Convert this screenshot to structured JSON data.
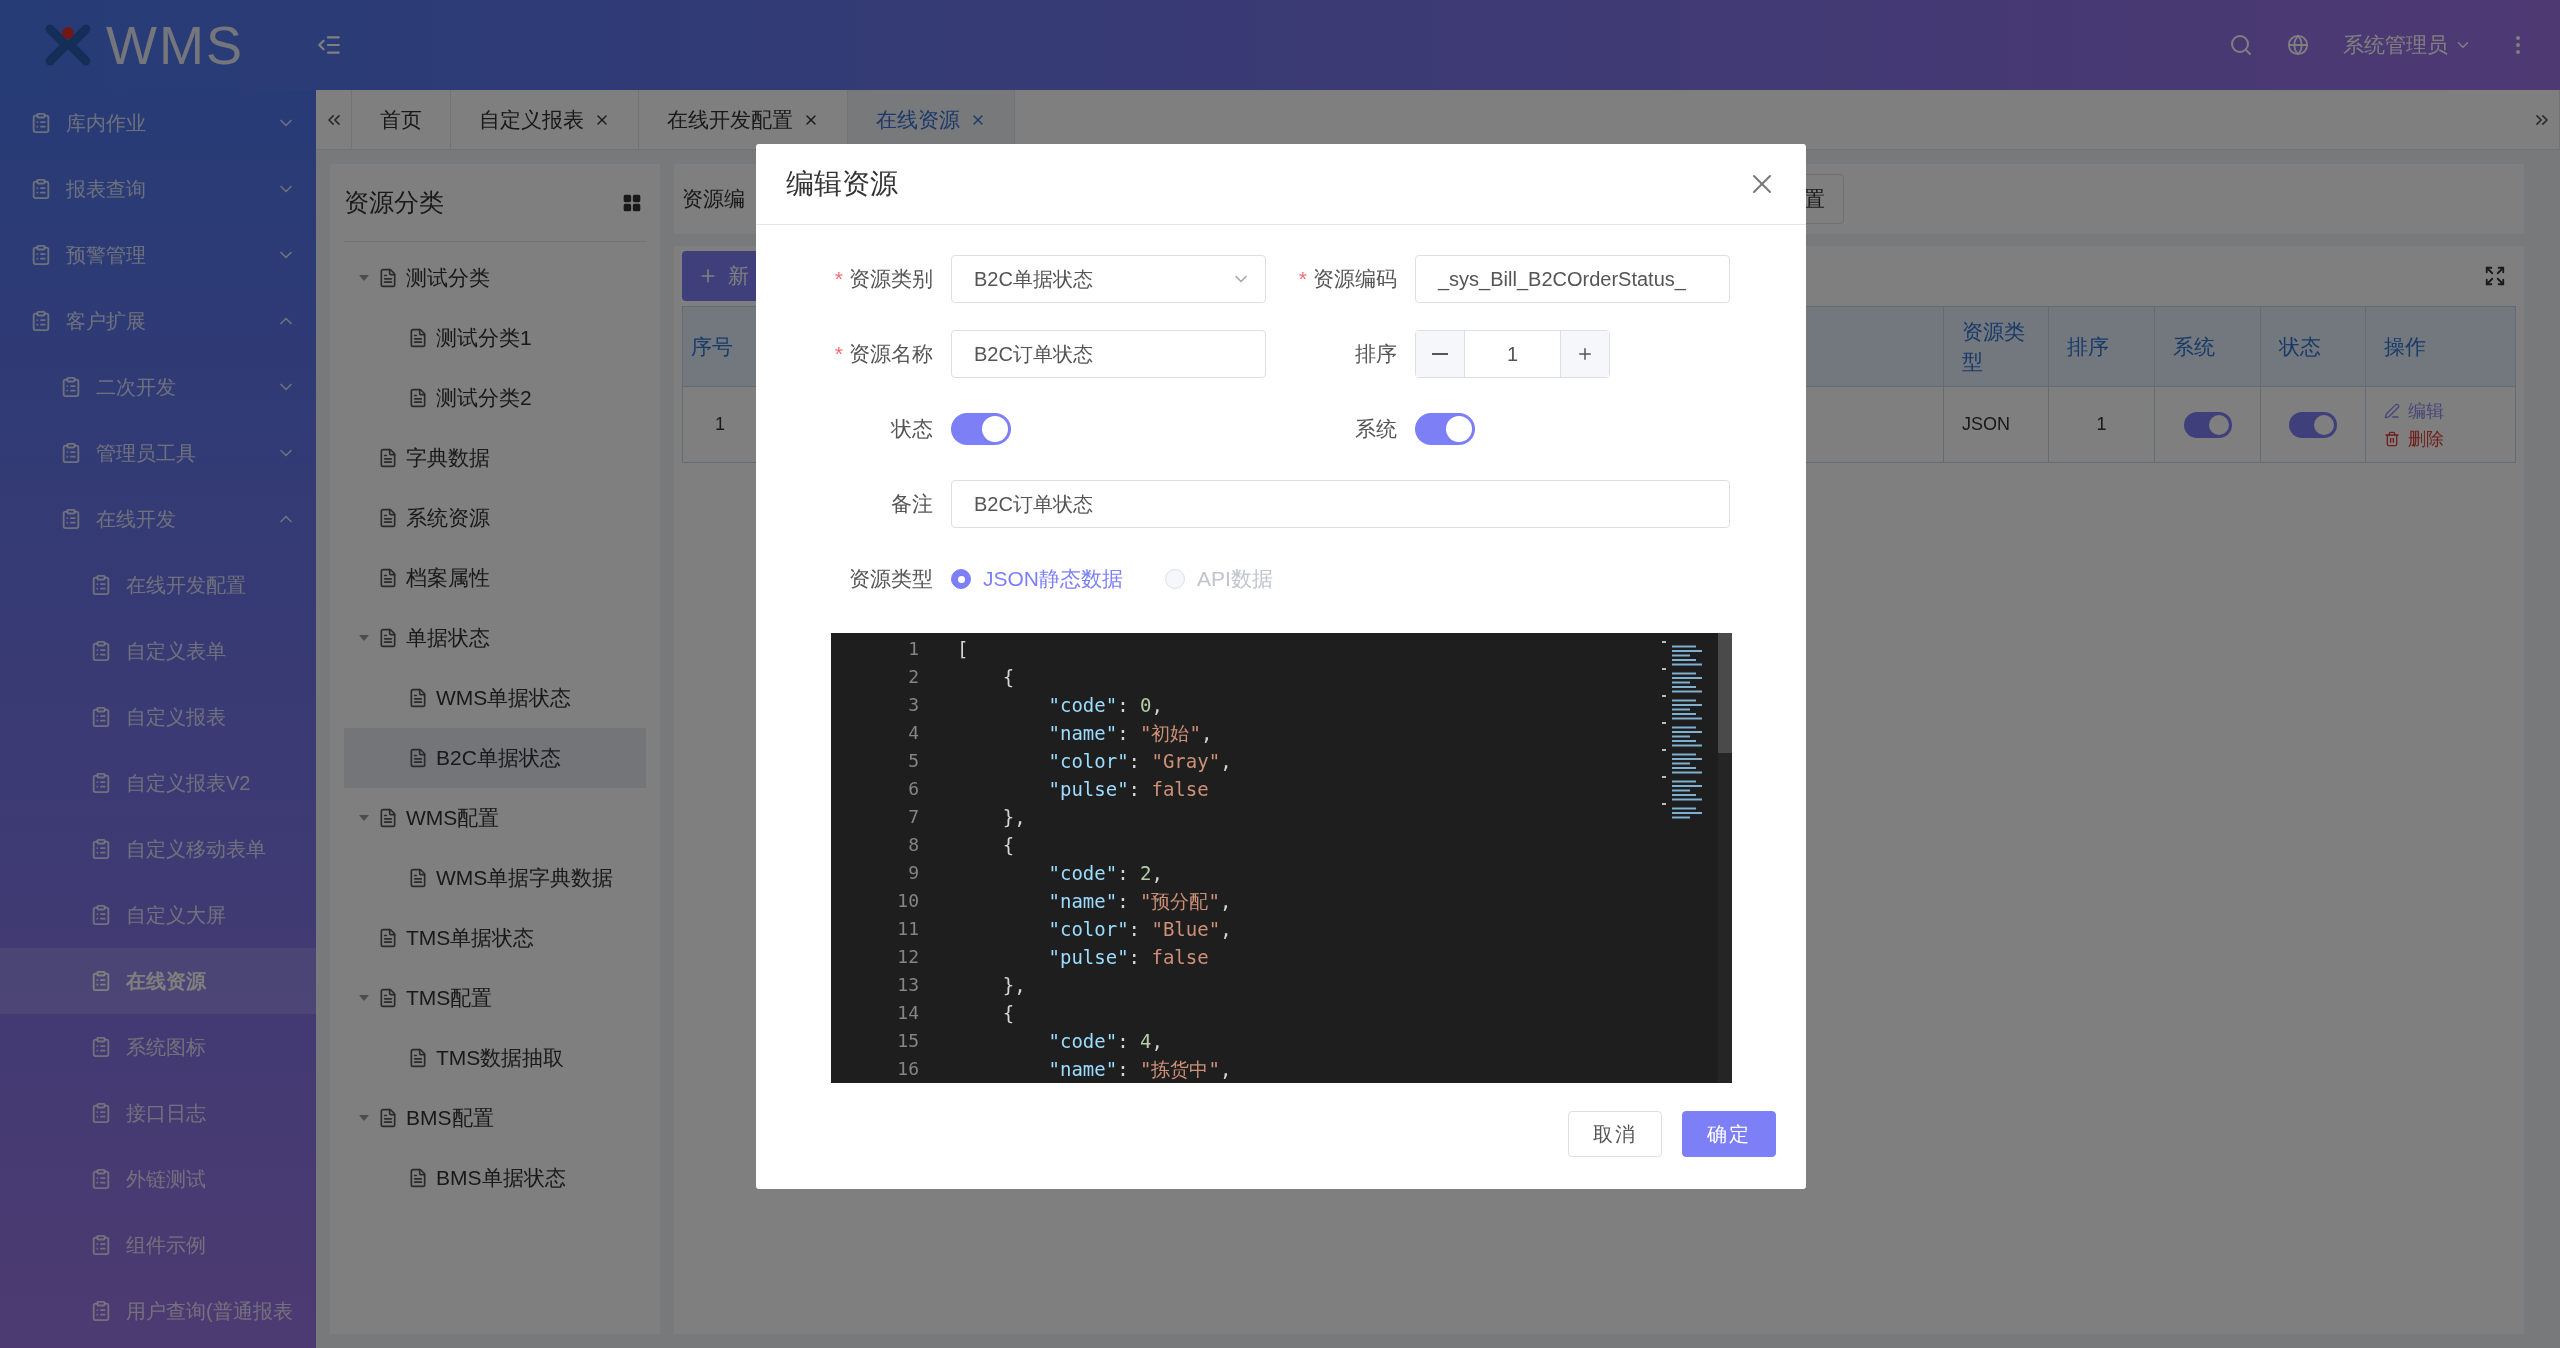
{
  "header": {
    "logo": "WMS",
    "user": "系统管理员"
  },
  "sidebar": {
    "items": [
      {
        "label": "库内作业",
        "selected": false,
        "expanded": false
      },
      {
        "label": "报表查询",
        "selected": false,
        "expanded": false
      },
      {
        "label": "预警管理",
        "selected": false,
        "expanded": false
      },
      {
        "label": "客户扩展",
        "selected": false,
        "expanded": true,
        "children": [
          {
            "label": "二次开发",
            "selected": false,
            "expanded": false
          },
          {
            "label": "管理员工具",
            "selected": false,
            "expanded": false
          },
          {
            "label": "在线开发",
            "selected": false,
            "expanded": true,
            "children": [
              {
                "label": "在线开发配置",
                "selected": false
              },
              {
                "label": "自定义表单",
                "selected": false
              },
              {
                "label": "自定义报表",
                "selected": false
              },
              {
                "label": "自定义报表V2",
                "selected": false
              },
              {
                "label": "自定义移动表单",
                "selected": false
              },
              {
                "label": "自定义大屏",
                "selected": false
              },
              {
                "label": "在线资源",
                "selected": true
              },
              {
                "label": "系统图标",
                "selected": false
              },
              {
                "label": "接口日志",
                "selected": false
              },
              {
                "label": "外链测试",
                "selected": false
              },
              {
                "label": "组件示例",
                "selected": false
              },
              {
                "label": "用户查询(普通报表",
                "selected": false
              }
            ]
          }
        ]
      }
    ]
  },
  "tabs": [
    {
      "label": "首页",
      "closable": false,
      "selected": false
    },
    {
      "label": "自定义报表",
      "closable": true,
      "selected": false
    },
    {
      "label": "在线开发配置",
      "closable": true,
      "selected": false
    },
    {
      "label": "在线资源",
      "closable": true,
      "selected": true
    }
  ],
  "tree": {
    "title": "资源分类",
    "items": [
      {
        "label": "测试分类",
        "selected": false,
        "expanded": true,
        "children": [
          {
            "label": "测试分类1",
            "selected": false
          },
          {
            "label": "测试分类2",
            "selected": false
          }
        ]
      },
      {
        "label": "字典数据",
        "selected": false
      },
      {
        "label": "系统资源",
        "selected": false
      },
      {
        "label": "档案属性",
        "selected": false
      },
      {
        "label": "单据状态",
        "selected": false,
        "expanded": true,
        "children": [
          {
            "label": "WMS单据状态",
            "selected": false
          },
          {
            "label": "B2C单据状态",
            "selected": true
          }
        ]
      },
      {
        "label": "WMS配置",
        "selected": false,
        "expanded": true,
        "children": [
          {
            "label": "WMS单据字典数据",
            "selected": false
          }
        ]
      },
      {
        "label": "TMS单据状态",
        "selected": false
      },
      {
        "label": "TMS配置",
        "selected": false,
        "expanded": true,
        "children": [
          {
            "label": "TMS数据抽取",
            "selected": false
          }
        ]
      },
      {
        "label": "BMS配置",
        "selected": false,
        "expanded": true,
        "children": [
          {
            "label": "BMS单据状态",
            "selected": false
          }
        ]
      }
    ]
  },
  "main": {
    "search_label": "资源编",
    "reset_button": "置",
    "add_button": "新",
    "table": {
      "columns": [
        "序号",
        "资源类型",
        "排序",
        "系统",
        "状态",
        "操作"
      ],
      "rows": [
        {
          "index": "1",
          "type": "JSON",
          "sort": "1",
          "system": true,
          "status": true,
          "edit": "编辑",
          "delete": "删除"
        }
      ]
    }
  },
  "modal": {
    "title": "编辑资源",
    "required_mark": "*",
    "category": {
      "label": "资源类别",
      "required": true,
      "value": "B2C单据状态"
    },
    "code": {
      "label": "资源编码",
      "required": true,
      "value": "_sys_Bill_B2COrderStatus_"
    },
    "name": {
      "label": "资源名称",
      "required": true,
      "value": "B2C订单状态"
    },
    "sort": {
      "label": "排序",
      "required": false,
      "value": "1"
    },
    "status": {
      "label": "状态",
      "on": true
    },
    "system": {
      "label": "系统",
      "on": true
    },
    "remark": {
      "label": "备注",
      "value": "B2C订单状态"
    },
    "resource_type": {
      "label": "资源类型",
      "options": [
        {
          "label": "JSON静态数据",
          "selected": true,
          "disabled": false
        },
        {
          "label": "API数据",
          "selected": false,
          "disabled": true
        }
      ]
    },
    "editor": {
      "lines": [
        {
          "no": "1",
          "tokens": [
            {
              "kind": "punct",
              "text": "["
            }
          ]
        },
        {
          "no": "2",
          "tokens": [
            {
              "kind": "punct",
              "text": "    {"
            }
          ]
        },
        {
          "no": "3",
          "tokens": [
            {
              "kind": "key",
              "text": "        \"code\""
            },
            {
              "kind": "punct",
              "text": ": "
            },
            {
              "kind": "number",
              "text": "0"
            },
            {
              "kind": "punct",
              "text": ","
            }
          ]
        },
        {
          "no": "4",
          "tokens": [
            {
              "kind": "key",
              "text": "        \"name\""
            },
            {
              "kind": "punct",
              "text": ": "
            },
            {
              "kind": "string",
              "text": "\"初始\""
            },
            {
              "kind": "punct",
              "text": ","
            }
          ]
        },
        {
          "no": "5",
          "tokens": [
            {
              "kind": "key",
              "text": "        \"color\""
            },
            {
              "kind": "punct",
              "text": ": "
            },
            {
              "kind": "string",
              "text": "\"Gray\""
            },
            {
              "kind": "punct",
              "text": ","
            }
          ]
        },
        {
          "no": "6",
          "tokens": [
            {
              "kind": "key",
              "text": "        \"pulse\""
            },
            {
              "kind": "punct",
              "text": ": "
            },
            {
              "kind": "keyword",
              "text": "false"
            }
          ]
        },
        {
          "no": "7",
          "tokens": [
            {
              "kind": "punct",
              "text": "    },"
            }
          ]
        },
        {
          "no": "8",
          "tokens": [
            {
              "kind": "punct",
              "text": "    {"
            }
          ]
        },
        {
          "no": "9",
          "tokens": [
            {
              "kind": "key",
              "text": "        \"code\""
            },
            {
              "kind": "punct",
              "text": ": "
            },
            {
              "kind": "number",
              "text": "2"
            },
            {
              "kind": "punct",
              "text": ","
            }
          ]
        },
        {
          "no": "10",
          "tokens": [
            {
              "kind": "key",
              "text": "        \"name\""
            },
            {
              "kind": "punct",
              "text": ": "
            },
            {
              "kind": "string",
              "text": "\"预分配\""
            },
            {
              "kind": "punct",
              "text": ","
            }
          ]
        },
        {
          "no": "11",
          "tokens": [
            {
              "kind": "key",
              "text": "        \"color\""
            },
            {
              "kind": "punct",
              "text": ": "
            },
            {
              "kind": "string",
              "text": "\"Blue\""
            },
            {
              "kind": "punct",
              "text": ","
            }
          ]
        },
        {
          "no": "12",
          "tokens": [
            {
              "kind": "key",
              "text": "        \"pulse\""
            },
            {
              "kind": "punct",
              "text": ": "
            },
            {
              "kind": "keyword",
              "text": "false"
            }
          ]
        },
        {
          "no": "13",
          "tokens": [
            {
              "kind": "punct",
              "text": "    },"
            }
          ]
        },
        {
          "no": "14",
          "tokens": [
            {
              "kind": "punct",
              "text": "    {"
            }
          ]
        },
        {
          "no": "15",
          "tokens": [
            {
              "kind": "key",
              "text": "        \"code\""
            },
            {
              "kind": "punct",
              "text": ": "
            },
            {
              "kind": "number",
              "text": "4"
            },
            {
              "kind": "punct",
              "text": ","
            }
          ]
        },
        {
          "no": "16",
          "tokens": [
            {
              "kind": "key",
              "text": "        \"name\""
            },
            {
              "kind": "punct",
              "text": ": "
            },
            {
              "kind": "string",
              "text": "\"拣货中\""
            },
            {
              "kind": "punct",
              "text": ","
            }
          ]
        }
      ]
    },
    "cancel": "取消",
    "ok": "确定"
  }
}
